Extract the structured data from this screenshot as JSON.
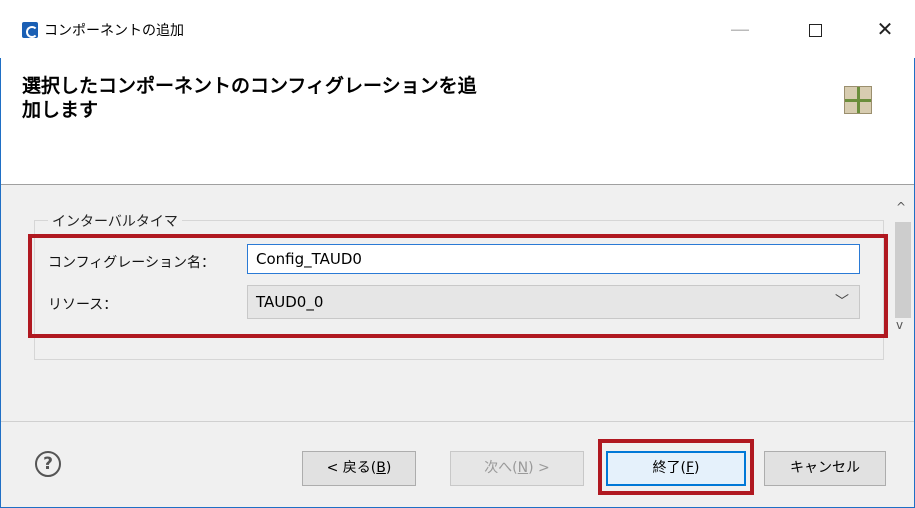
{
  "window": {
    "title": "コンポーネントの追加",
    "minimize_glyph": "—",
    "close_glyph": "✕"
  },
  "header": {
    "heading_line1": "選択したコンポーネントのコンフィグレーションを追",
    "heading_line2": "加します"
  },
  "group": {
    "label": "インターバルタイマ",
    "config_name_label": "コンフィグレーション名：",
    "config_name_value": "Config_TAUD0",
    "resource_label": "リソース：",
    "resource_value": "TAUD0_0",
    "resource_chevron": "﹀"
  },
  "scrollbar": {
    "up": "^",
    "down": "v"
  },
  "footer": {
    "help": "?",
    "back_label": "< 戻る(",
    "back_key": "B",
    "next_label": "次へ(",
    "next_key": "N",
    "next_suffix": ") >",
    "finish_label": "終了(",
    "finish_key": "F",
    "cancel_label": "キャンセル",
    "close_paren": ")"
  },
  "colors": {
    "highlight": "#b01820",
    "accent": "#0078d7",
    "frame": "#1f6fc5"
  }
}
